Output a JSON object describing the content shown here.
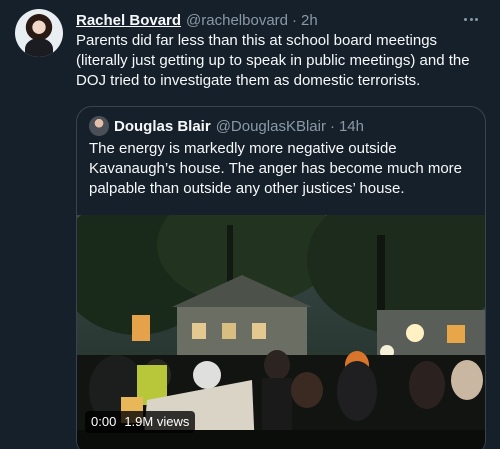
{
  "tweet": {
    "author_name": "Rachel Bovard",
    "author_handle": "@rachelbovard",
    "separator": "·",
    "time": "2h",
    "text": "Parents did far less than this at school board meetings (literally just getting up to speak in public meetings) and the DOJ tried to investigate them as domestic terrorists.",
    "more_icon": "more-horizontal-icon"
  },
  "quote": {
    "author_name": "Douglas Blair",
    "author_handle": "@DouglasKBlair",
    "separator": "·",
    "time": "14h",
    "text": "The energy is markedly more negative outside Kavanaugh’s house. The anger has become much more palpable than outside any other justices’ house.",
    "video": {
      "duration": "0:00",
      "views": "1.9M views"
    }
  },
  "colors": {
    "background": "#15202b",
    "text_primary": "#f7f9f9",
    "text_secondary": "#8b98a5",
    "border": "#38444d"
  }
}
